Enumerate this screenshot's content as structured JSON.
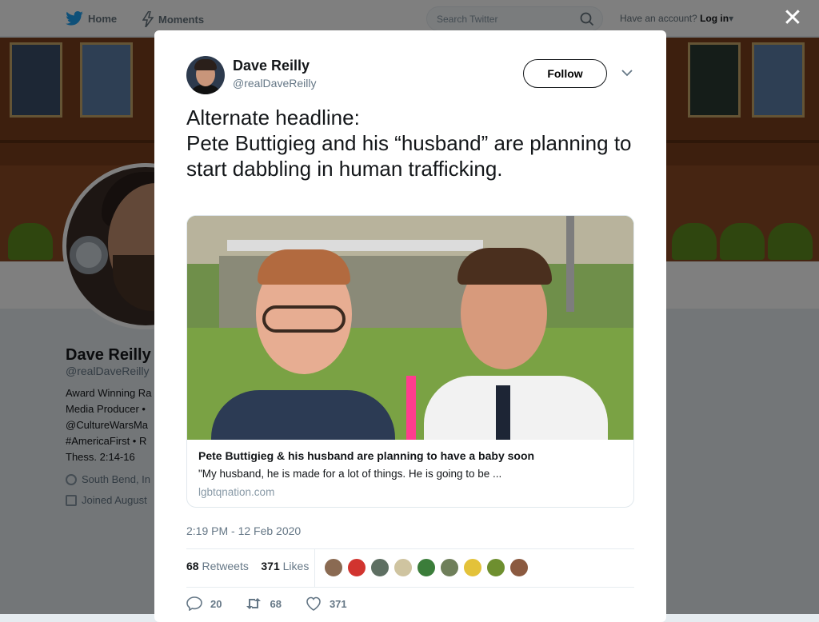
{
  "nav": {
    "home_label": "Home",
    "moments_label": "Moments",
    "search_placeholder": "Search Twitter",
    "account_prompt": "Have an account?",
    "login_label": "Log in"
  },
  "profile": {
    "name": "Dave Reilly",
    "handle": "@realDaveReilly",
    "bio_lines": [
      "Award Winning Ra",
      "Media Producer •",
      "@CultureWarsMa",
      "#AmericaFirst • R",
      "Thess. 2:14-16"
    ],
    "location": "South Bend, In",
    "joined": "Joined August"
  },
  "tweet": {
    "author_name": "Dave Reilly",
    "author_handle": "@realDaveReilly",
    "follow_label": "Follow",
    "text": "Alternate headline:\nPete Buttigieg and his “husband” are planning to start dabbling in human trafficking.",
    "card": {
      "title": "Pete Buttigieg & his husband are planning to have a baby soon",
      "description": "\"My husband, he is made for a lot of things. He is going to be ...",
      "domain": "lgbtqnation.com"
    },
    "timestamp": "2:19 PM - 12 Feb 2020",
    "retweets_count": "68",
    "retweets_label": "Retweets",
    "likes_count": "371",
    "likes_label": "Likes",
    "reply_count": "20",
    "retweet_action_count": "68",
    "like_action_count": "371",
    "liker_colors": [
      "#8a6a52",
      "#d1342f",
      "#5e6f62",
      "#cfc4a0",
      "#3b7d3a",
      "#6f7f5a",
      "#e3c23a",
      "#6e8f2f",
      "#8b5a40"
    ]
  },
  "colors": {
    "accent": "#1da1f2",
    "text": "#14171a",
    "muted": "#657786"
  }
}
